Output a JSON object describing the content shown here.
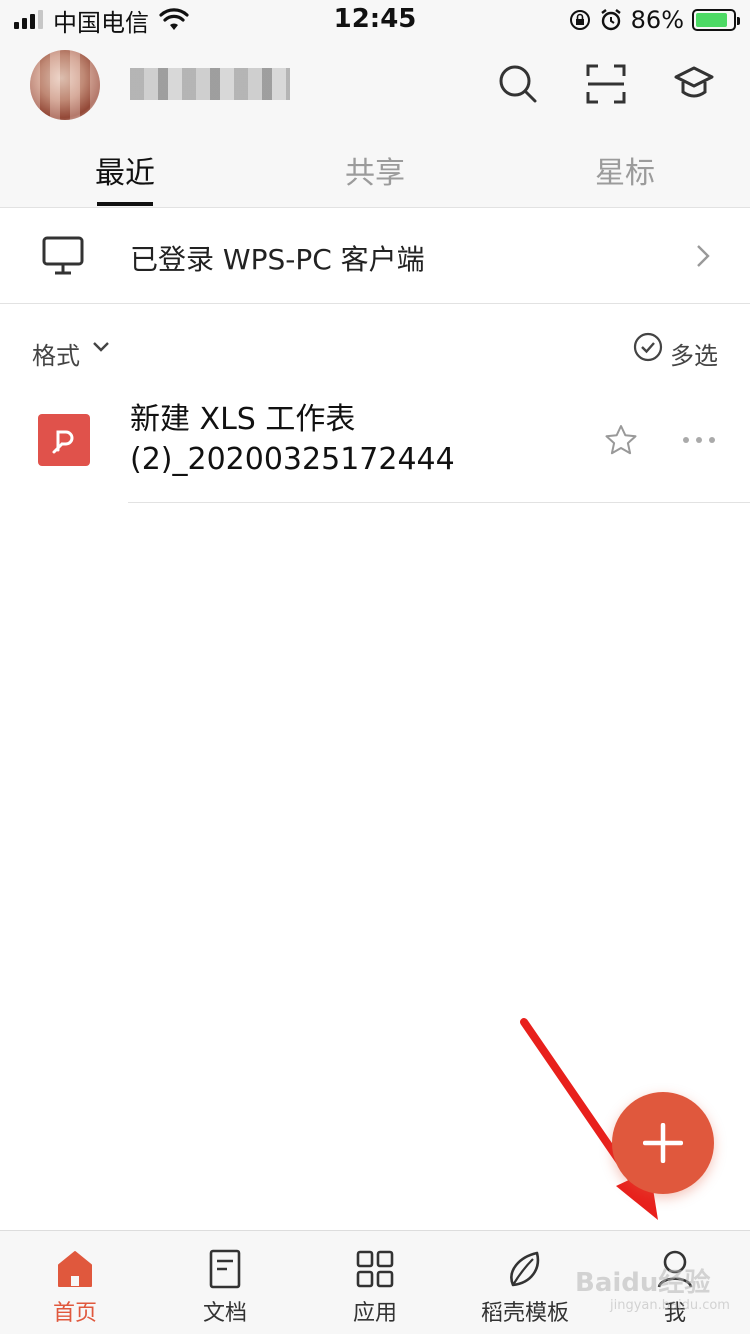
{
  "status_bar": {
    "carrier": "中国电信",
    "time": "12:45",
    "battery_percent": "86%",
    "battery_level": 0.86
  },
  "header": {
    "avatar_icon": "user-avatar",
    "search_icon": "search-icon",
    "scan_icon": "scan-icon",
    "academy_icon": "graduation-cap-icon",
    "tabs": [
      {
        "label": "最近",
        "active": true
      },
      {
        "label": "共享",
        "active": false
      },
      {
        "label": "星标",
        "active": false
      }
    ]
  },
  "pc_login": {
    "text": "已登录 WPS-PC 客户端",
    "icon": "monitor-icon"
  },
  "filter": {
    "format_label": "格式",
    "multi_select_label": "多选"
  },
  "files": [
    {
      "name_line1": "新建 XLS 工作表",
      "name_line2": "(2)_20200325172444",
      "icon": "wps-pdf-icon",
      "color": "#e0524b",
      "starred": false
    }
  ],
  "fab": {
    "icon": "plus-icon",
    "color": "#e0583d"
  },
  "bottom_nav": [
    {
      "label": "首页",
      "icon": "home-icon",
      "active": true
    },
    {
      "label": "文档",
      "icon": "document-icon",
      "active": false
    },
    {
      "label": "应用",
      "icon": "apps-grid-icon",
      "active": false
    },
    {
      "label": "稻壳模板",
      "icon": "leaf-icon",
      "active": false
    },
    {
      "label": "我",
      "icon": "person-icon",
      "active": false
    }
  ],
  "colors": {
    "accent": "#e0583d",
    "annotation": "#e8201c"
  },
  "watermark": {
    "text": "Baidu经验",
    "sub": "jingyan.baidu.com"
  }
}
